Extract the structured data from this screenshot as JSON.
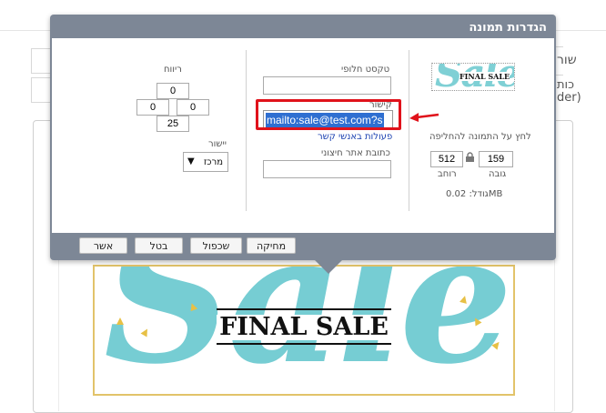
{
  "background": {
    "side_text_1": "שור",
    "side_text_2": "כות",
    "side_text_3": "der)",
    "banner": {
      "big_word": "Sale",
      "tagline": "FINAL SALE"
    }
  },
  "dialog": {
    "title": "הגדרות תמונה",
    "image_panel": {
      "thumb_word": "Sale",
      "thumb_tagline": "FINAL SALE",
      "replace_hint": "לחץ על התמונה להחליפה",
      "width_value": "512",
      "height_value": "159",
      "width_label": "רוחב",
      "height_label": "גובה",
      "size_text": "גודל: 0.02MB"
    },
    "fields": {
      "alt_label": "טקסט חלופי",
      "alt_value": "",
      "link_label": "קישור",
      "link_value": "mailto:sale@test.com?s",
      "contact_actions": "פעולות באנשי קשר",
      "external_label": "כתובת אתר חיצוני",
      "external_value": ""
    },
    "layout": {
      "spacing_label": "ריווח",
      "spacing_top": "0",
      "spacing_left": "0",
      "spacing_right": "0",
      "spacing_bottom": "25",
      "align_label": "יישור",
      "align_value": "מרכז"
    },
    "buttons": {
      "approve": "אשר",
      "cancel": "בטל",
      "duplicate": "שכפול",
      "delete": "מחיקה"
    }
  },
  "colors": {
    "dialog_header": "#7d8796",
    "highlight": "#e0121b",
    "banner_teal": "#76cdd3",
    "banner_gold": "#e2c36a"
  }
}
